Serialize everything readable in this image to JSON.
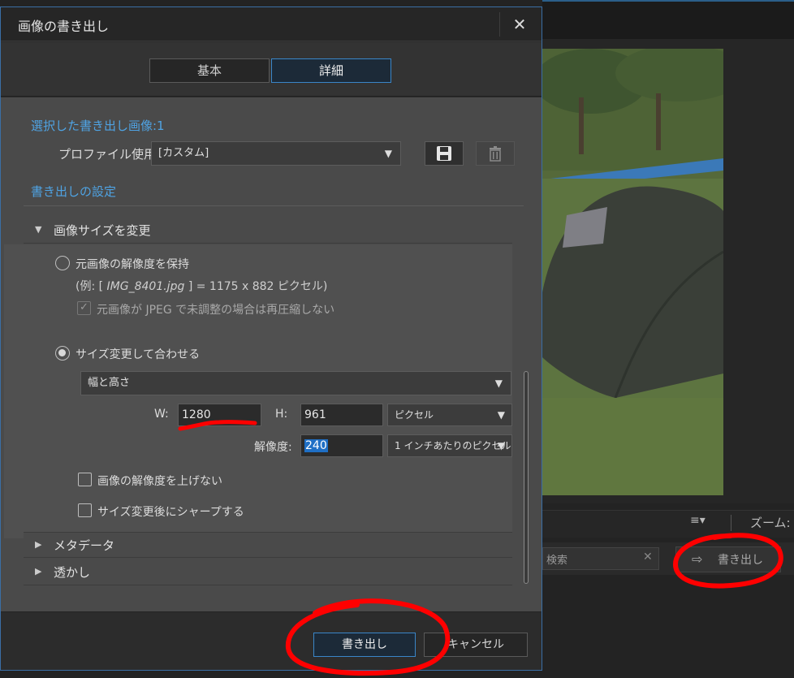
{
  "dialog": {
    "title": "画像の書き出し",
    "close_icon": "close-icon",
    "tabs": [
      {
        "label": "基本",
        "active": false
      },
      {
        "label": "詳細",
        "active": true
      }
    ],
    "selected_label": "選択した書き出し画像:1",
    "profile": {
      "label": "プロファイル使用:",
      "value": "[カスタム]",
      "save_icon": "floppy-disk-icon",
      "delete_icon": "trash-icon"
    },
    "settings_label": "書き出しの設定",
    "resize_section": {
      "title": "画像サイズを変更",
      "expanded": true,
      "keep_original": {
        "label": "元画像の解像度を保持",
        "selected": false,
        "example": "(例: [",
        "example_file": "IMG_8401.jpg",
        "example_rest": "] =  1175 x 882  ピクセル)",
        "no_recompress_label": "元画像が JPEG で未調整の場合は再圧縮しない",
        "no_recompress_checked": true
      },
      "resize_fit": {
        "label": "サイズ変更して合わせる",
        "selected": true,
        "mode": "幅と高さ",
        "w_label": "W:",
        "w_value": "1280",
        "h_label": "H:",
        "h_value": "961",
        "unit": "ピクセル",
        "resolution_label": "解像度:",
        "resolution_value": "240",
        "resolution_unit": "1 インチあたりのピクセル"
      },
      "no_upscale_label": "画像の解像度を上げない",
      "sharpen_label": "サイズ変更後にシャープする"
    },
    "metadata_section": "メタデータ",
    "watermark_section": "透かし",
    "export_button": "書き出し",
    "cancel_button": "キャンセル"
  },
  "background": {
    "zoom_label": "ズーム:",
    "search_placeholder": "検索",
    "export_label": "書き出し",
    "list_icon": "list-view-icon"
  },
  "annotation_color": "#ff0000"
}
